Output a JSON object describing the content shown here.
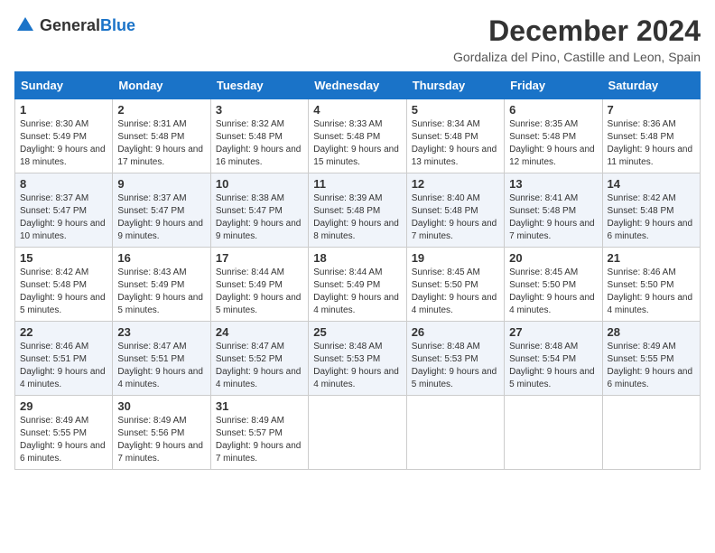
{
  "header": {
    "logo_general": "General",
    "logo_blue": "Blue",
    "main_title": "December 2024",
    "subtitle": "Gordaliza del Pino, Castille and Leon, Spain"
  },
  "columns": [
    "Sunday",
    "Monday",
    "Tuesday",
    "Wednesday",
    "Thursday",
    "Friday",
    "Saturday"
  ],
  "weeks": [
    [
      {
        "day": "1",
        "sunrise": "Sunrise: 8:30 AM",
        "sunset": "Sunset: 5:49 PM",
        "daylight": "Daylight: 9 hours and 18 minutes."
      },
      {
        "day": "2",
        "sunrise": "Sunrise: 8:31 AM",
        "sunset": "Sunset: 5:48 PM",
        "daylight": "Daylight: 9 hours and 17 minutes."
      },
      {
        "day": "3",
        "sunrise": "Sunrise: 8:32 AM",
        "sunset": "Sunset: 5:48 PM",
        "daylight": "Daylight: 9 hours and 16 minutes."
      },
      {
        "day": "4",
        "sunrise": "Sunrise: 8:33 AM",
        "sunset": "Sunset: 5:48 PM",
        "daylight": "Daylight: 9 hours and 15 minutes."
      },
      {
        "day": "5",
        "sunrise": "Sunrise: 8:34 AM",
        "sunset": "Sunset: 5:48 PM",
        "daylight": "Daylight: 9 hours and 13 minutes."
      },
      {
        "day": "6",
        "sunrise": "Sunrise: 8:35 AM",
        "sunset": "Sunset: 5:48 PM",
        "daylight": "Daylight: 9 hours and 12 minutes."
      },
      {
        "day": "7",
        "sunrise": "Sunrise: 8:36 AM",
        "sunset": "Sunset: 5:48 PM",
        "daylight": "Daylight: 9 hours and 11 minutes."
      }
    ],
    [
      {
        "day": "8",
        "sunrise": "Sunrise: 8:37 AM",
        "sunset": "Sunset: 5:47 PM",
        "daylight": "Daylight: 9 hours and 10 minutes."
      },
      {
        "day": "9",
        "sunrise": "Sunrise: 8:37 AM",
        "sunset": "Sunset: 5:47 PM",
        "daylight": "Daylight: 9 hours and 9 minutes."
      },
      {
        "day": "10",
        "sunrise": "Sunrise: 8:38 AM",
        "sunset": "Sunset: 5:47 PM",
        "daylight": "Daylight: 9 hours and 9 minutes."
      },
      {
        "day": "11",
        "sunrise": "Sunrise: 8:39 AM",
        "sunset": "Sunset: 5:48 PM",
        "daylight": "Daylight: 9 hours and 8 minutes."
      },
      {
        "day": "12",
        "sunrise": "Sunrise: 8:40 AM",
        "sunset": "Sunset: 5:48 PM",
        "daylight": "Daylight: 9 hours and 7 minutes."
      },
      {
        "day": "13",
        "sunrise": "Sunrise: 8:41 AM",
        "sunset": "Sunset: 5:48 PM",
        "daylight": "Daylight: 9 hours and 7 minutes."
      },
      {
        "day": "14",
        "sunrise": "Sunrise: 8:42 AM",
        "sunset": "Sunset: 5:48 PM",
        "daylight": "Daylight: 9 hours and 6 minutes."
      }
    ],
    [
      {
        "day": "15",
        "sunrise": "Sunrise: 8:42 AM",
        "sunset": "Sunset: 5:48 PM",
        "daylight": "Daylight: 9 hours and 5 minutes."
      },
      {
        "day": "16",
        "sunrise": "Sunrise: 8:43 AM",
        "sunset": "Sunset: 5:49 PM",
        "daylight": "Daylight: 9 hours and 5 minutes."
      },
      {
        "day": "17",
        "sunrise": "Sunrise: 8:44 AM",
        "sunset": "Sunset: 5:49 PM",
        "daylight": "Daylight: 9 hours and 5 minutes."
      },
      {
        "day": "18",
        "sunrise": "Sunrise: 8:44 AM",
        "sunset": "Sunset: 5:49 PM",
        "daylight": "Daylight: 9 hours and 4 minutes."
      },
      {
        "day": "19",
        "sunrise": "Sunrise: 8:45 AM",
        "sunset": "Sunset: 5:50 PM",
        "daylight": "Daylight: 9 hours and 4 minutes."
      },
      {
        "day": "20",
        "sunrise": "Sunrise: 8:45 AM",
        "sunset": "Sunset: 5:50 PM",
        "daylight": "Daylight: 9 hours and 4 minutes."
      },
      {
        "day": "21",
        "sunrise": "Sunrise: 8:46 AM",
        "sunset": "Sunset: 5:50 PM",
        "daylight": "Daylight: 9 hours and 4 minutes."
      }
    ],
    [
      {
        "day": "22",
        "sunrise": "Sunrise: 8:46 AM",
        "sunset": "Sunset: 5:51 PM",
        "daylight": "Daylight: 9 hours and 4 minutes."
      },
      {
        "day": "23",
        "sunrise": "Sunrise: 8:47 AM",
        "sunset": "Sunset: 5:51 PM",
        "daylight": "Daylight: 9 hours and 4 minutes."
      },
      {
        "day": "24",
        "sunrise": "Sunrise: 8:47 AM",
        "sunset": "Sunset: 5:52 PM",
        "daylight": "Daylight: 9 hours and 4 minutes."
      },
      {
        "day": "25",
        "sunrise": "Sunrise: 8:48 AM",
        "sunset": "Sunset: 5:53 PM",
        "daylight": "Daylight: 9 hours and 4 minutes."
      },
      {
        "day": "26",
        "sunrise": "Sunrise: 8:48 AM",
        "sunset": "Sunset: 5:53 PM",
        "daylight": "Daylight: 9 hours and 5 minutes."
      },
      {
        "day": "27",
        "sunrise": "Sunrise: 8:48 AM",
        "sunset": "Sunset: 5:54 PM",
        "daylight": "Daylight: 9 hours and 5 minutes."
      },
      {
        "day": "28",
        "sunrise": "Sunrise: 8:49 AM",
        "sunset": "Sunset: 5:55 PM",
        "daylight": "Daylight: 9 hours and 6 minutes."
      }
    ],
    [
      {
        "day": "29",
        "sunrise": "Sunrise: 8:49 AM",
        "sunset": "Sunset: 5:55 PM",
        "daylight": "Daylight: 9 hours and 6 minutes."
      },
      {
        "day": "30",
        "sunrise": "Sunrise: 8:49 AM",
        "sunset": "Sunset: 5:56 PM",
        "daylight": "Daylight: 9 hours and 7 minutes."
      },
      {
        "day": "31",
        "sunrise": "Sunrise: 8:49 AM",
        "sunset": "Sunset: 5:57 PM",
        "daylight": "Daylight: 9 hours and 7 minutes."
      },
      null,
      null,
      null,
      null
    ]
  ]
}
